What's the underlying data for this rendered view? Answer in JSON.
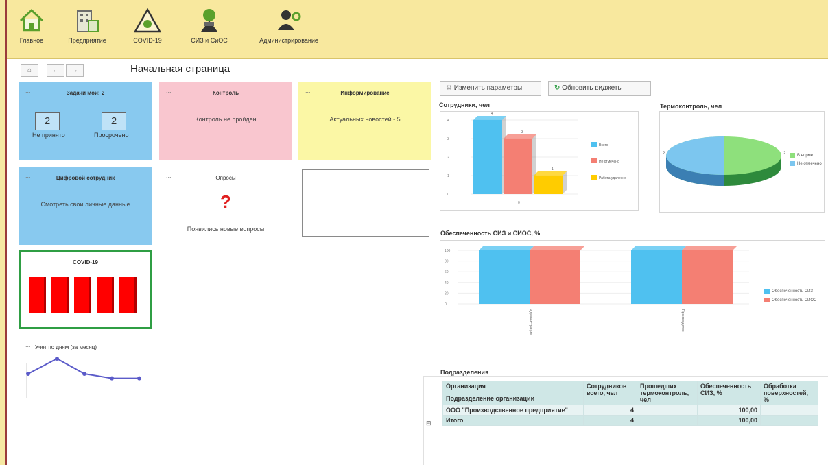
{
  "toolbar": {
    "items": [
      {
        "label": "Главное",
        "icon": "home-icon"
      },
      {
        "label": "Предприятие",
        "icon": "buildings-icon"
      },
      {
        "label": "COVID-19",
        "icon": "biohazard-icon"
      },
      {
        "label": "СИЗ и СиОС",
        "icon": "protective-gear-icon"
      },
      {
        "label": "Администрирование",
        "icon": "admin-icon"
      }
    ]
  },
  "nav": {
    "home": "⌂",
    "back": "←",
    "forward": "→",
    "title": "Начальная страница"
  },
  "tiles": {
    "tasks": {
      "dash": "...",
      "title": "Задачи мои: 2",
      "not_accepted_value": "2",
      "not_accepted_label": "Не принято",
      "overdue_value": "2",
      "overdue_label": "Просрочено"
    },
    "control": {
      "dash": "...",
      "title": "Контроль",
      "text": "Контроль не пройден"
    },
    "info": {
      "dash": "...",
      "title": "Информирование",
      "text": "Актуальных новостей - 5"
    },
    "digital": {
      "dash": "...",
      "title": "Цифровой сотрудник",
      "text": "Смотреть свои личные данные"
    },
    "polls": {
      "dash": "...",
      "title": "Опросы",
      "mark": "?",
      "text": "Появились новые вопросы"
    },
    "covid": {
      "dash": "...",
      "title": "COVID-19",
      "bars": 5
    },
    "daily": {
      "dash": "...",
      "title": "Учет по дням (за месяц)",
      "points": [
        3,
        5,
        3,
        2.4,
        2.4
      ]
    }
  },
  "buttons": {
    "change_params": "Изменить параметры",
    "refresh": "Обновить виджеты"
  },
  "employees_chart": {
    "title": "Сотрудники, чел",
    "yticks": [
      "4",
      "3",
      "2",
      "1",
      "0"
    ],
    "xlabel": "0",
    "series": [
      {
        "name": "Всего",
        "value": 4,
        "label": "4",
        "color": "#4fc1f0"
      },
      {
        "name": "Не отмечено",
        "value": 3,
        "label": "3",
        "color": "#f47f73"
      },
      {
        "name": "Работа удаленно",
        "value": 1,
        "label": "1",
        "color": "#ffcc00"
      }
    ]
  },
  "thermo_chart": {
    "title": "Термоконтроль, чел",
    "left_label": "2",
    "right_label": "2",
    "series": [
      {
        "name": "В норме",
        "value": 2,
        "color": "#8ee07c"
      },
      {
        "name": "Не отмечено",
        "value": 2,
        "color": "#7cc6ef"
      }
    ]
  },
  "provision_chart": {
    "title": "Обеспеченность СИЗ и СИОС, %",
    "yticks": [
      "100",
      "80",
      "60",
      "40",
      "20",
      "0"
    ],
    "categories": [
      "Администрация",
      "Производство"
    ],
    "series": [
      {
        "name": "Обеспеченность СИЗ",
        "values": [
          100,
          100
        ],
        "color": "#4fc1f0"
      },
      {
        "name": "Обеспеченность СИОС",
        "values": [
          100,
          100
        ],
        "color": "#f47f73"
      }
    ]
  },
  "departments": {
    "title": "Подразделения",
    "col_org": "Организация",
    "col_subdiv": "Подразделение организации",
    "col_employees": "Сотрудников всего, чел",
    "col_thermo": "Прошедших термоконтроль, чел",
    "col_provision": "Обеспеченность СИЗ, %",
    "col_surface": "Обработка поверхностей, %",
    "rows": [
      {
        "marker": "⊟",
        "org": "ООО \"Производственное предприятие\"",
        "employees": "4",
        "thermo": "",
        "provision": "100,00",
        "surface": ""
      },
      {
        "marker": "",
        "org": "Итого",
        "employees": "4",
        "thermo": "",
        "provision": "100,00",
        "surface": ""
      }
    ]
  }
}
